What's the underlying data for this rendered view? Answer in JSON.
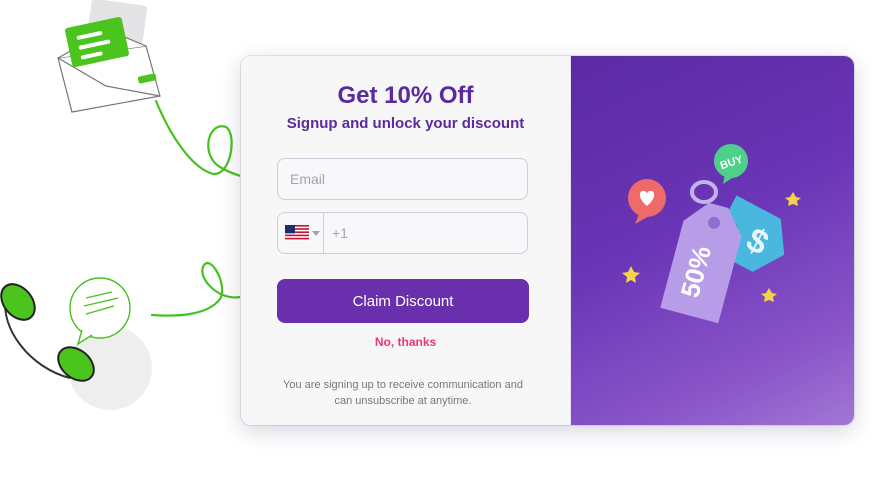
{
  "form": {
    "title": "Get 10% Off",
    "subtitle": "Signup and unlock your discount",
    "email_placeholder": "Email",
    "phone_prefix_placeholder": "+1",
    "country_flag_icon": "us-flag-icon",
    "claim_button_label": "Claim Discount",
    "decline_link_label": "No, thanks",
    "disclaimer": "You are signing up to receive communication and can unsubscribe at anytime."
  },
  "illustration": {
    "discount_tag_text": "50%",
    "dollar_tag_text": "$",
    "speech_bubble_text": "BUY"
  },
  "colors": {
    "brand_purple": "#6a2fad",
    "title_purple": "#5b2a9e",
    "decline_pink": "#e8397a",
    "accent_green": "#45c21f"
  }
}
